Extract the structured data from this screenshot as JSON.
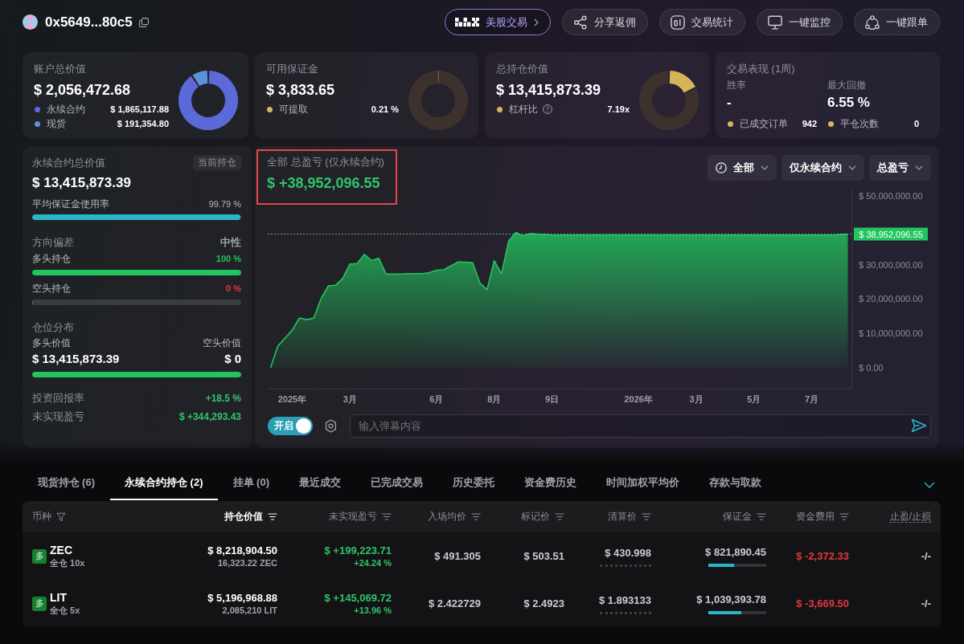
{
  "header": {
    "address": "0x5649...80c5",
    "actions": [
      {
        "kind": "promo",
        "label": "美股交易"
      },
      {
        "kind": "share",
        "label": "分享返佣"
      },
      {
        "kind": "stats",
        "label": "交易统计"
      },
      {
        "kind": "monitor",
        "label": "一键监控"
      },
      {
        "kind": "follow",
        "label": "一键跟单"
      }
    ]
  },
  "summary_cards": [
    {
      "kind": "donut",
      "title": "账户总价值",
      "value": "$ 2,056,472.68",
      "legend": [
        {
          "label": "永续合约",
          "value": "$ 1,865,117.88",
          "color": "#5b6ad8",
          "help": false
        },
        {
          "label": "现货",
          "value": "$ 191,354.80",
          "color": "#5b92d9",
          "help": false
        }
      ],
      "chart_data": {
        "type": "donut",
        "values": [
          90.7,
          9.3
        ]
      }
    },
    {
      "kind": "donut",
      "title": "可用保证金",
      "value": "$ 3,833.65",
      "legend": [
        {
          "label": "可提取",
          "value": "0.21 %",
          "color": "#d6b45c",
          "help": false
        }
      ],
      "chart_data": {
        "type": "donut",
        "values": [
          0.21,
          99.79
        ]
      }
    },
    {
      "kind": "donut",
      "title": "总持仓价值",
      "value": "$ 13,415,873.39",
      "legend": [
        {
          "label": "杠杆比",
          "value": "7.19x",
          "color": "#d6b45c",
          "help": true
        }
      ],
      "chart_data": {
        "type": "donut",
        "values": [
          18,
          82
        ]
      }
    },
    {
      "kind": "stats",
      "title": "交易表现 (1周)",
      "columns": [
        {
          "label": "胜率",
          "value": "-",
          "legend": {
            "label": "已成交订单",
            "value": "942",
            "color": "#d6b45c"
          }
        },
        {
          "label": "最大回撤",
          "value": "6.55 %",
          "legend": {
            "label": "平仓次数",
            "value": "0",
            "color": "#d6b45c"
          }
        }
      ]
    }
  ],
  "position_panel": {
    "title": "永续合约总价值",
    "badge": "当前持仓",
    "value": "$ 13,415,873.39",
    "usage": {
      "label": "平均保证金使用率",
      "reading": "99.79 %",
      "level": 0.9979
    },
    "bias": {
      "label": "方向偏差",
      "value": "中性"
    },
    "sides": [
      {
        "label": "多头持仓",
        "reading": "100 %",
        "level": 1,
        "color": "#22c55e"
      },
      {
        "label": "空头持仓",
        "reading": "0 %",
        "level": 0,
        "color": "#e5383b"
      }
    ],
    "distribution": {
      "label": "仓位分布",
      "long_label": "多头价值",
      "short_label": "空头价值",
      "long_value": "$ 13,415,873.39",
      "short_value": "$ 0",
      "level": 1
    },
    "metrics": [
      {
        "label": "投资回报率",
        "value": "+18.5 %"
      },
      {
        "label": "未实现盈亏",
        "value": "$ +344,293.43"
      }
    ]
  },
  "pnl_chart": {
    "title": "全部 总盈亏 (仅永续合约)",
    "value": "$ +38,952,096.55",
    "highlighted": true,
    "filters": [
      {
        "kind": "period",
        "label": "全部"
      },
      {
        "kind": "market",
        "label": "仅永续合约"
      },
      {
        "kind": "metric",
        "label": "总盈亏"
      }
    ],
    "chart_data": {
      "type": "area",
      "categories": [
        null,
        null,
        null,
        "2025年",
        null,
        null,
        null,
        null,
        null,
        null,
        null,
        "3月",
        null,
        null,
        null,
        null,
        null,
        null,
        null,
        null,
        null,
        null,
        null,
        "6月",
        null,
        null,
        null,
        null,
        null,
        null,
        null,
        "8月",
        null,
        null,
        null,
        null,
        null,
        null,
        null,
        "9日",
        null,
        null,
        null,
        null,
        null,
        null,
        null,
        null,
        null,
        null,
        null,
        "2026年",
        null,
        null,
        null,
        null,
        null,
        null,
        null,
        "3月",
        null,
        null,
        null,
        null,
        null,
        null,
        null,
        "5月",
        null,
        null,
        null,
        null,
        null,
        null,
        null,
        "7月",
        null,
        null,
        null,
        null,
        null
      ],
      "series": [
        {
          "color": "#22c55e",
          "values": [
            0,
            6300000,
            8600000,
            10900000,
            14500000,
            14000000,
            14500000,
            20100000,
            23800000,
            24000000,
            26000000,
            30200000,
            30300000,
            33000000,
            31200000,
            31900000,
            27300000,
            27300000,
            27300000,
            27400000,
            27400000,
            27400000,
            27700000,
            28400000,
            28500000,
            29700000,
            30800000,
            30700000,
            30600000,
            24700000,
            22700000,
            31200000,
            27300000,
            36900000,
            39400000,
            38400000,
            39100000,
            38900000,
            38800000,
            38600000,
            38600000,
            38600000,
            38600000,
            38600000,
            38600000,
            38600000,
            38600000,
            38600000,
            38600000,
            38600000,
            38600000,
            38600000,
            38600000,
            38600000,
            38600000,
            38600000,
            38600000,
            38600000,
            38600000,
            38600000,
            38600000,
            38600000,
            38600000,
            38600000,
            38600000,
            38600000,
            38600000,
            38600000,
            38600000,
            38600000,
            38600000,
            38600000,
            38600000,
            38600000,
            38600000,
            38600000,
            38600000,
            38600000,
            38600000,
            38800000,
            38900000
          ]
        }
      ],
      "ylim": [
        -6070000,
        51870000
      ],
      "yticks": [
        {
          "value": 0,
          "label": "$ 0.00"
        },
        {
          "value": 10000000,
          "label": "$ 10,000,000.00"
        },
        {
          "value": 20000000,
          "label": "$ 20,000,000.00"
        },
        {
          "value": 30000000,
          "label": "$ 30,000,000.00"
        },
        {
          "value": 50000000,
          "label": "$ 50,000,000.00"
        }
      ]
    },
    "current_value_tag": "$ 38,952,096.55",
    "danmaku": {
      "toggle_label": "开启",
      "on": true,
      "placeholder": "输入弹幕内容"
    }
  },
  "positions": {
    "tabs": [
      {
        "label": "现货持仓 (6)",
        "selected": false
      },
      {
        "label": "永续合约持仓 (2)",
        "selected": true
      },
      {
        "label": "挂单 (0)",
        "selected": false
      },
      {
        "label": "最近成交",
        "selected": false
      },
      {
        "label": "已完成交易",
        "selected": false
      },
      {
        "label": "历史委托",
        "selected": false
      },
      {
        "label": "资金费历史",
        "selected": false
      },
      {
        "label": "时间加权平均价",
        "selected": false
      },
      {
        "label": "存款与取款",
        "selected": false
      }
    ],
    "columns": [
      {
        "label": "币种",
        "kind": "filter",
        "active": false
      },
      {
        "label": "持仓价值",
        "kind": "sort",
        "active": true
      },
      {
        "label": "未实现盈亏",
        "kind": "sort",
        "active": false
      },
      {
        "label": "入场均价",
        "kind": "sort",
        "active": false
      },
      {
        "label": "标记价",
        "kind": "sort",
        "active": false
      },
      {
        "label": "清算价",
        "kind": "sort",
        "active": false
      },
      {
        "label": "保证金",
        "kind": "sort",
        "active": false
      },
      {
        "label": "资金费用",
        "kind": "sort",
        "active": false
      },
      {
        "label": "止盈/止损",
        "kind": "hint",
        "active": false
      }
    ],
    "rows": [
      {
        "side": "多",
        "symbol": "ZEC",
        "mode": "全仓 10x",
        "value": "$ 8,218,904.50",
        "size": "16,323.22 ZEC",
        "pnl": "$ +199,223.71",
        "pnl_pct": "+24.24 %",
        "entry": "$ 491.305",
        "mark": "$ 503.51",
        "liquidation": "$ 430.998",
        "margin": {
          "value": "$ 821,890.45",
          "level": 0.45
        },
        "funding": "$ -2,372.33",
        "tpsl": "-/-"
      },
      {
        "side": "多",
        "symbol": "LIT",
        "mode": "全仓 5x",
        "value": "$ 5,196,968.88",
        "size": "2,085,210 LIT",
        "pnl": "$ +145,069.72",
        "pnl_pct": "+13.96 %",
        "entry": "$ 2.422729",
        "mark": "$ 2.4923",
        "liquidation": "$ 1.893133",
        "margin": {
          "value": "$ 1,039,393.78",
          "level": 0.57
        },
        "funding": "$ -3,669.50",
        "tpsl": "-/-"
      }
    ]
  }
}
